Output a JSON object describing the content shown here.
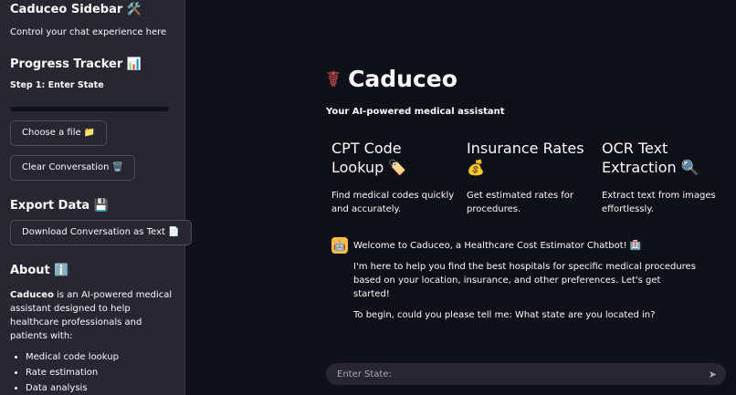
{
  "sidebar": {
    "title": "Caduceo Sidebar 🛠️",
    "subtitle": "Control your chat experience here",
    "progress_heading": "Progress Tracker 📊",
    "step": "Step 1: Enter State",
    "progress_fraction": 0,
    "choose_file": "Choose a file 📁",
    "clear_conversation": "Clear Conversation 🗑️",
    "export_heading": "Export Data 💾",
    "download_label": "Download Conversation as Text 📄",
    "about_heading": "About ℹ️",
    "about_bold": "Caduceo",
    "about_text": " is an AI-powered medical assistant designed to help healthcare professionals and patients with:",
    "about_items": [
      "Medical code lookup",
      "Rate estimation",
      "Data analysis"
    ]
  },
  "main": {
    "logo_emoji": "☤",
    "title": "Caduceo",
    "tagline": "Your AI-powered medical assistant",
    "cards": [
      {
        "title": "CPT Code Lookup 🏷️",
        "desc": "Find medical codes quickly and accurately."
      },
      {
        "title": "Insurance Rates 💰",
        "desc": "Get estimated rates for procedures."
      },
      {
        "title": "OCR Text Extraction 🔍",
        "desc": "Extract text from images effortlessly."
      }
    ],
    "chat": {
      "line1": "Welcome to Caduceo, a Healthcare Cost Estimator Chatbot! 🏥",
      "line2": "I'm here to help you find the best hospitals for specific medical procedures based on your location, insurance, and other preferences. Let's get started!",
      "line3": "To begin, could you please tell me: What state are you located in?"
    },
    "input_placeholder": "Enter State:"
  }
}
